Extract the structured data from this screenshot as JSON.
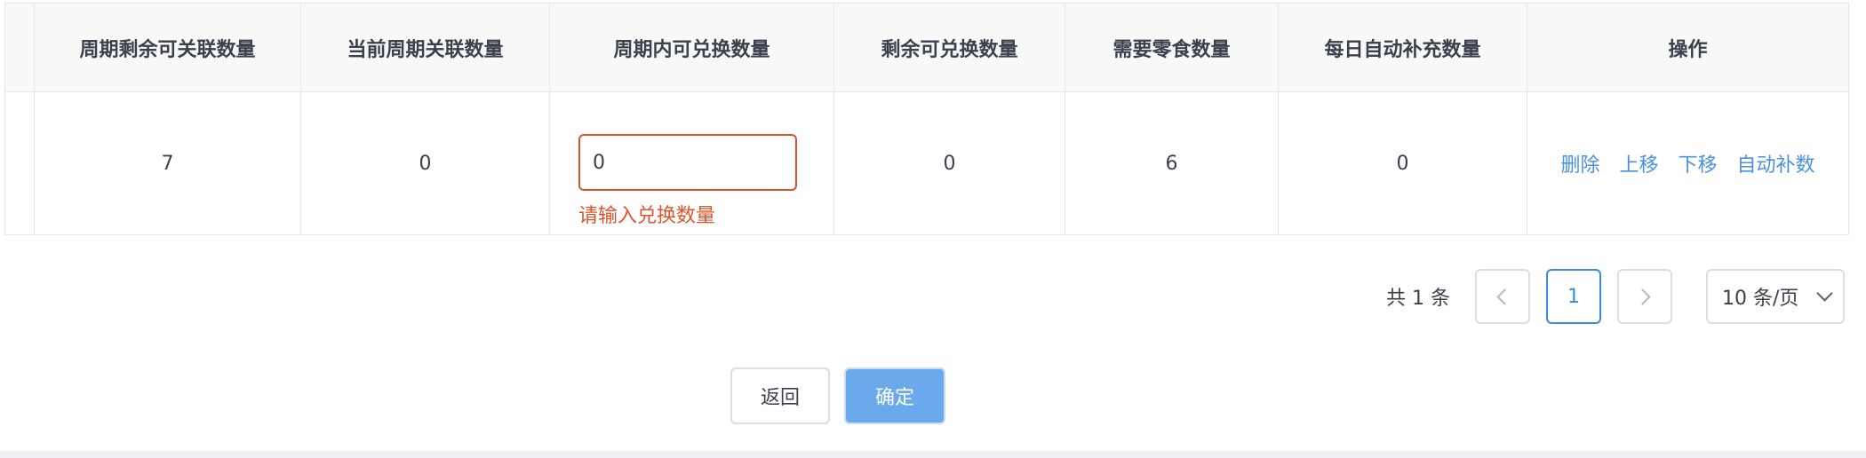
{
  "table": {
    "columns": [
      "周期剩余可关联数量",
      "当前周期关联数量",
      "周期内可兑换数量",
      "剩余可兑换数量",
      "需要零食数量",
      "每日自动补充数量",
      "操作"
    ],
    "row": {
      "remaining_linkable": "7",
      "current_linked": "0",
      "exchangeable_input_value": "0",
      "exchangeable_error": "请输入兑换数量",
      "remaining_exchangeable": "0",
      "snacks_needed": "6",
      "daily_auto_refill": "0",
      "actions": [
        "删除",
        "上移",
        "下移",
        "自动补数"
      ]
    }
  },
  "pagination": {
    "total_text": "共 1 条",
    "current_page": "1",
    "page_size": "10 条/页"
  },
  "footer": {
    "back_label": "返回",
    "confirm_label": "确定"
  },
  "colors": {
    "error": "#d9552b",
    "link": "#4a90e2",
    "primary": "#6aa9eb",
    "border": "#e4e7ec"
  }
}
